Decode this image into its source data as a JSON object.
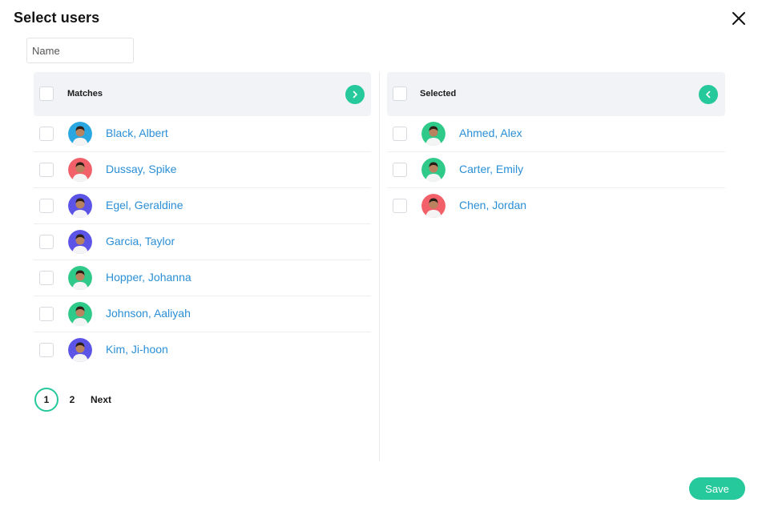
{
  "dialog": {
    "title": "Select users",
    "close_icon": "close-icon"
  },
  "search": {
    "placeholder": "Name",
    "value": ""
  },
  "matches": {
    "header_label": "Matches",
    "move_icon": "chevron-right-icon",
    "users": [
      {
        "name": "Black, Albert",
        "avatar_color": "#2aa6e0"
      },
      {
        "name": "Dussay, Spike",
        "avatar_color": "#f2616a"
      },
      {
        "name": "Egel, Geraldine",
        "avatar_color": "#5b54e6"
      },
      {
        "name": "Garcia, Taylor",
        "avatar_color": "#5b54e6"
      },
      {
        "name": "Hopper, Johanna",
        "avatar_color": "#2fca8a"
      },
      {
        "name": "Johnson, Aaliyah",
        "avatar_color": "#2fca8a"
      },
      {
        "name": "Kim, Ji-hoon",
        "avatar_color": "#5b54e6"
      }
    ]
  },
  "selected": {
    "header_label": "Selected",
    "move_icon": "chevron-left-icon",
    "users": [
      {
        "name": "Ahmed, Alex",
        "avatar_color": "#2fca8a"
      },
      {
        "name": "Carter, Emily",
        "avatar_color": "#2fca8a"
      },
      {
        "name": "Chen, Jordan",
        "avatar_color": "#f2616a"
      }
    ]
  },
  "pagination": {
    "pages": [
      "1",
      "2"
    ],
    "current": "1",
    "next_label": "Next"
  },
  "footer": {
    "save_label": "Save"
  },
  "colors": {
    "accent": "#26c99b",
    "link": "#2a8fd6"
  }
}
